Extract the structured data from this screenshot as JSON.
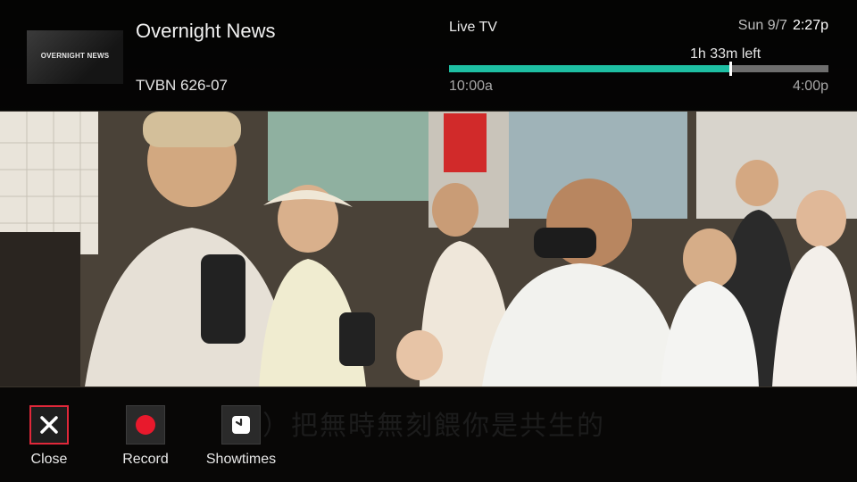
{
  "program": {
    "title": "Overnight News",
    "thumbnail_text": "OVERNIGHT NEWS",
    "channel": "TVBN 626-07"
  },
  "status": {
    "mode": "Live TV",
    "date": "Sun 9/7",
    "time": "2:27p",
    "time_left": "1h 33m left",
    "start_time": "10:00a",
    "end_time": "4:00p",
    "progress": 0.74,
    "accent_color": "#1ebfa3"
  },
  "video": {
    "subtitle": "（頻）把無時無刻餵你是共生的"
  },
  "actions": {
    "close": {
      "label": "Close",
      "icon": "close-icon",
      "focused": true
    },
    "record": {
      "label": "Record",
      "icon": "record-icon"
    },
    "showtimes": {
      "label": "Showtimes",
      "icon": "clock-icon"
    }
  },
  "colors": {
    "focus": "#e0283a",
    "record": "#e8192c"
  }
}
